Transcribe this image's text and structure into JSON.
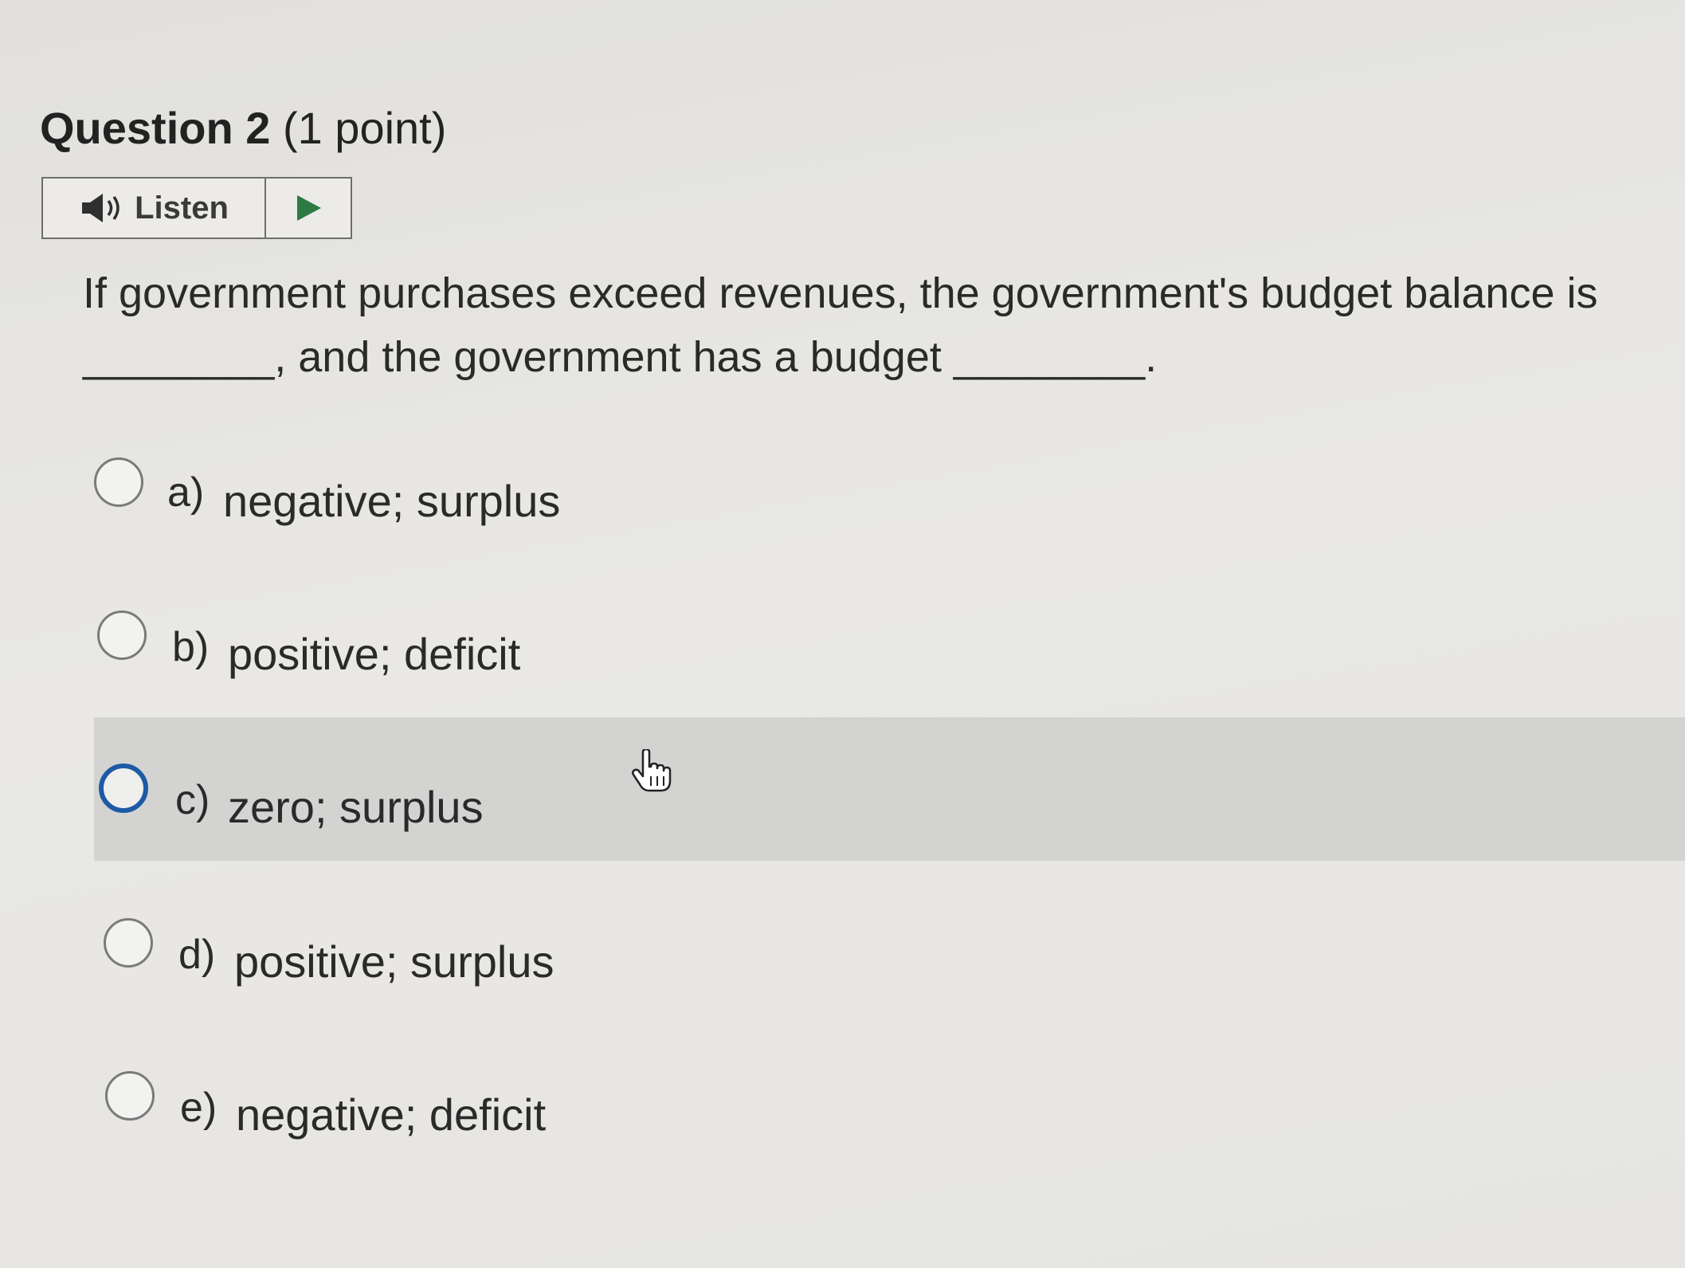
{
  "question": {
    "number_label": "Question 2",
    "points_label": "(1 point)"
  },
  "listen": {
    "label": "Listen",
    "speaker_icon": "speaker-icon",
    "play_icon": "play-icon"
  },
  "prompt": {
    "line1": "If government purchases exceed revenues, the government's budget balance is",
    "line2": "________, and the government has a budget ________."
  },
  "choices": [
    {
      "letter": "a)",
      "text": "negative; surplus"
    },
    {
      "letter": "b)",
      "text": "positive; deficit"
    },
    {
      "letter": "c)",
      "text": "zero; surplus"
    },
    {
      "letter": "d)",
      "text": "positive; surplus"
    },
    {
      "letter": "e)",
      "text": "negative; deficit"
    }
  ],
  "colors": {
    "radio_hover_border": "#1c5aa6",
    "hover_row_bg": "#d3d3d1",
    "play_icon": "#2d7a45"
  }
}
